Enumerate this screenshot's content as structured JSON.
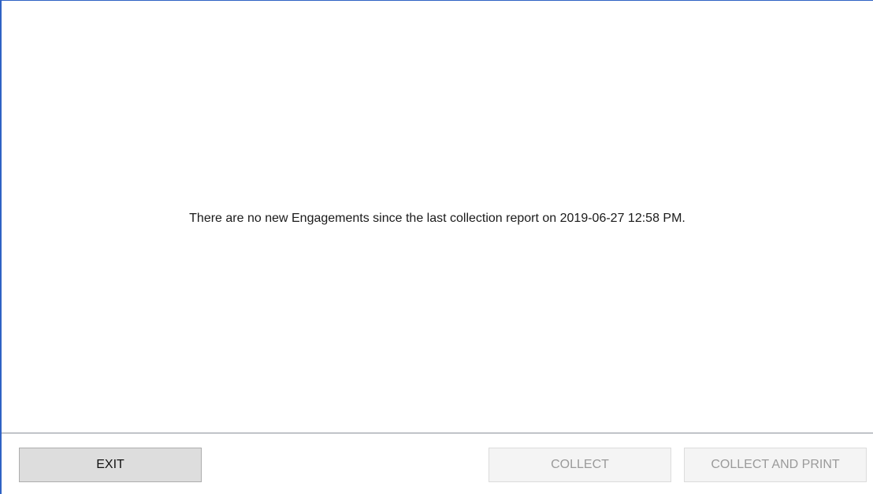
{
  "main": {
    "message": "There are no new Engagements since the last collection report on 2019-06-27 12:58 PM."
  },
  "footer": {
    "exit_label": "EXIT",
    "collect_label": "COLLECT",
    "collect_and_print_label": "COLLECT AND PRINT",
    "collect_enabled": false,
    "collect_and_print_enabled": false
  },
  "colors": {
    "window_border": "#2f62c4",
    "divider": "#8a8f99",
    "disabled_text": "#9a9a9a"
  }
}
